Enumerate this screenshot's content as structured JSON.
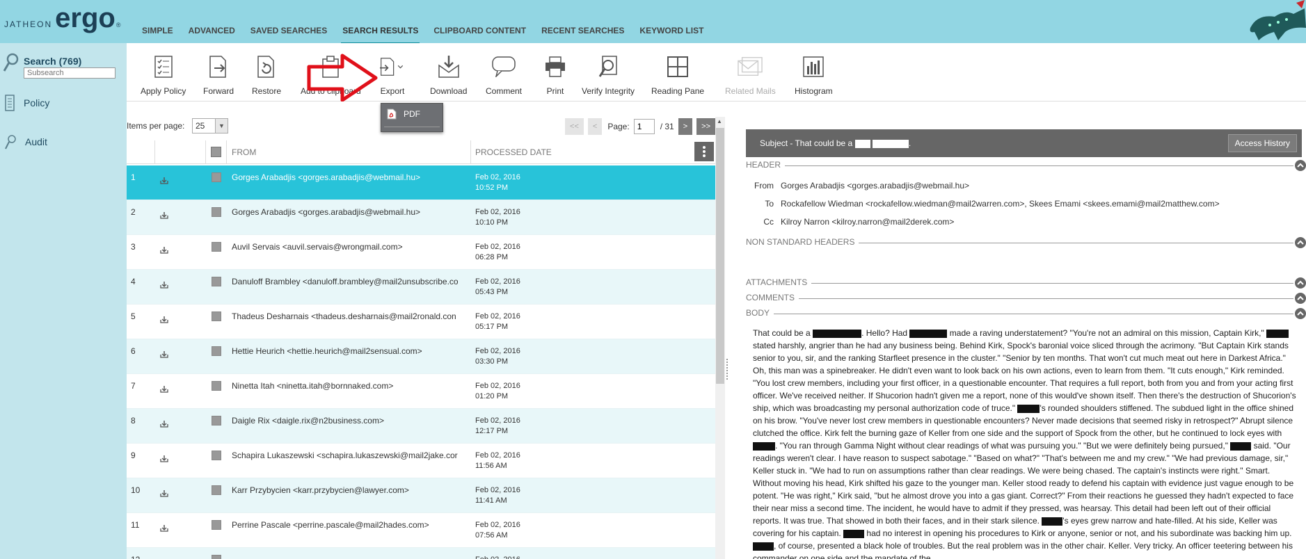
{
  "app": {
    "logo_prefix": "JATHEON",
    "logo_main": "erg",
    "logo_o": "o",
    "logo_tm": "®"
  },
  "nav": {
    "items": [
      {
        "label": "SIMPLE",
        "active": false
      },
      {
        "label": "ADVANCED",
        "active": false
      },
      {
        "label": "SAVED SEARCHES",
        "active": false
      },
      {
        "label": "SEARCH RESULTS",
        "active": true
      },
      {
        "label": "CLIPBOARD CONTENT",
        "active": false
      },
      {
        "label": "RECENT SEARCHES",
        "active": false
      },
      {
        "label": "KEYWORD LIST",
        "active": false
      }
    ]
  },
  "sidebar": {
    "search_label": "Search (769)",
    "subsearch_placeholder": "Subsearch",
    "policy_label": "Policy",
    "audit_label": "Audit"
  },
  "toolbar": {
    "apply_policy": "Apply Policy",
    "forward": "Forward",
    "restore": "Restore",
    "add_to_clipboard": "Add to clipboard",
    "export": "Export",
    "download": "Download",
    "comment": "Comment",
    "print": "Print",
    "verify_integrity": "Verify Integrity",
    "reading_pane": "Reading Pane",
    "related_mails": "Related Mails",
    "histogram": "Histogram"
  },
  "export_menu": {
    "pdf_label": "PDF"
  },
  "list": {
    "items_per_page_label": "Items per page:",
    "items_per_page_value": "25",
    "pager": {
      "first": "<<",
      "prev": "<",
      "page_label": "Page:",
      "page_value": "1",
      "total": "/  31",
      "next": ">",
      "last": ">>"
    },
    "headers": {
      "from": "FROM",
      "processed_date": "PROCESSED DATE"
    },
    "rows": [
      {
        "num": "1",
        "from": "Gorges Arabadjis <gorges.arabadjis@webmail.hu>",
        "date": "Feb 02, 2016",
        "time": "10:52 PM"
      },
      {
        "num": "2",
        "from": "Gorges Arabadjis <gorges.arabadjis@webmail.hu>",
        "date": "Feb 02, 2016",
        "time": "10:10 PM"
      },
      {
        "num": "3",
        "from": "Auvil Servais <auvil.servais@wrongmail.com>",
        "date": "Feb 02, 2016",
        "time": "06:28 PM"
      },
      {
        "num": "4",
        "from": "Danuloff Brambley <danuloff.brambley@mail2unsubscribe.co",
        "date": "Feb 02, 2016",
        "time": "05:43 PM"
      },
      {
        "num": "5",
        "from": "Thadeus Desharnais <thadeus.desharnais@mail2ronald.con",
        "date": "Feb 02, 2016",
        "time": "05:17 PM"
      },
      {
        "num": "6",
        "from": "Hettie Heurich <hettie.heurich@mail2sensual.com>",
        "date": "Feb 02, 2016",
        "time": "03:30 PM"
      },
      {
        "num": "7",
        "from": "Ninetta Itah <ninetta.itah@bornnaked.com>",
        "date": "Feb 02, 2016",
        "time": "01:20 PM"
      },
      {
        "num": "8",
        "from": "Daigle Rix <daigle.rix@n2business.com>",
        "date": "Feb 02, 2016",
        "time": "12:17 PM"
      },
      {
        "num": "9",
        "from": "Schapira Lukaszewski <schapira.lukaszewski@mail2jake.cor",
        "date": "Feb 02, 2016",
        "time": "11:56 AM"
      },
      {
        "num": "10",
        "from": "Karr Przybycien <karr.przybycien@lawyer.com>",
        "date": "Feb 02, 2016",
        "time": "11:41 AM"
      },
      {
        "num": "11",
        "from": "Perrine Pascale <perrine.pascale@mail2hades.com>",
        "date": "Feb 02, 2016",
        "time": "07:56 AM"
      },
      {
        "num": "12",
        "from": "",
        "date": "Feb 02, 2016",
        "time": ""
      }
    ]
  },
  "reading_pane": {
    "subject_prefix": "Subject - That could be a",
    "subject_suffix": ".",
    "access_history": "Access History",
    "sections": {
      "header": "HEADER",
      "non_standard": "NON STANDARD HEADERS",
      "attachments": "ATTACHMENTS",
      "comments": "COMMENTS",
      "body": "BODY"
    },
    "from_label": "From",
    "from_value": "Gorges Arabadjis <gorges.arabadjis@webmail.hu>",
    "to_label": "To",
    "to_value": "Rockafellow Wiedman <rockafellow.wiedman@mail2warren.com>, Skees Emami <skees.emami@mail2matthew.com>",
    "cc_label": "Cc",
    "cc_value": "Kilroy Narron <kilroy.narron@mail2derek.com>",
    "body_segments": [
      "That could be a ",
      "[R]",
      ". Hello? Had ",
      "[R]",
      " made a raving understatement? \"You're not an admiral on this mission, Captain Kirk,\" ",
      "[R]",
      " stated harshly, angrier than he had any business being. Behind Kirk, Spock's baronial voice sliced through the acrimony. \"But Captain Kirk stands senior to you, sir, and the ranking Starfleet presence in the cluster.\" \"Senior by ten months. That won't cut much meat out here in Darkest Africa.\" Oh, this man was a spinebreaker. He didn't even want to look back on his own actions, even to learn from them. \"It cuts enough,\" Kirk reminded. \"You lost crew members, including your first officer, in a questionable encounter. That requires a full report, both from you and from your acting first officer. We've received neither. If Shucorion hadn't given me a report, none of this would've shown itself. Then there's the destruction of Shucorion's ship, which was broadcasting my personal authorization code of truce.\" ",
      "[R]",
      "'s rounded shoulders stiffened. The subdued light in the office shined on his brow. \"You've never lost crew members in questionable encounters? Never made decisions that seemed risky in retrospect?\" Abrupt silence clutched the office. Kirk felt the burning gaze of Keller from one side and the support of Spock from the other, but he continued to lock eyes with ",
      "[R]",
      ". \"You ran through Gamma Night without clear readings of what was pursuing you.\" \"But we were definitely being pursued,\" ",
      "[R]",
      " said. \"Our readings weren't clear. I have reason to suspect sabotage.\" \"Based on what?\" \"That's between me and my crew.\" \"We had previous damage, sir,\" Keller stuck in. \"We had to run on assumptions rather than clear readings. We were being chased. The captain's instincts were right.\" Smart. Without moving his head, Kirk shifted his gaze to the younger man. Keller stood ready to defend his captain with evidence just vague enough to be potent. \"He was right,\" Kirk said, \"but he almost drove you into a gas giant. Correct?\" From their reactions he guessed they hadn't expected to face their near miss a second time. The incident, he would have to admit if they pressed, was hearsay. This detail had been left out of their official reports. It was true. That showed in both their faces, and in their stark silence. ",
      "[R]",
      "'s eyes grew narrow and hate-filled. At his side, Keller was covering for his captain. ",
      "[R]",
      " had no interest in opening his procedures to Kirk or anyone, senior or not, and his subordinate was backing him up. ",
      "[R]",
      ", of course, presented a black hole of troubles. But the real problem was in the other chair. Keller. Very tricky. An officer teetering between his commander on one side and the mandate of the"
    ],
    "body_redaction_widths": [
      70,
      54,
      32,
      32,
      32,
      30,
      30,
      30,
      30
    ]
  }
}
